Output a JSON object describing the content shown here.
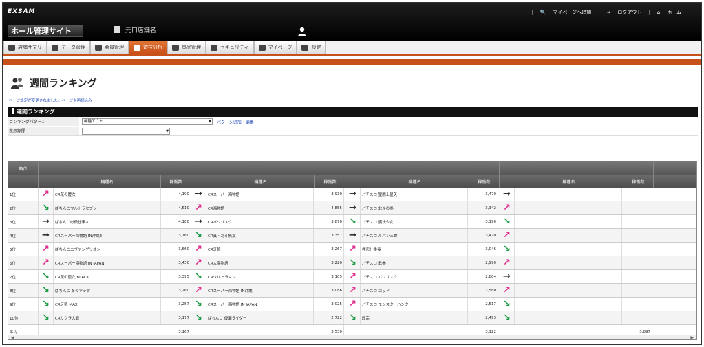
{
  "header": {
    "logo": "EXSAM",
    "site_title": "ホール管理サイト",
    "branch": "元口店舗名",
    "links": [
      "マイページへ追加",
      "ログアウト",
      "ホーム"
    ]
  },
  "nav": {
    "tabs": [
      {
        "label": "店舗サマリ",
        "active": false
      },
      {
        "label": "データ管理",
        "active": false
      },
      {
        "label": "会員管理",
        "active": false
      },
      {
        "label": "遊技分析",
        "active": true
      },
      {
        "label": "景品管理",
        "active": false
      },
      {
        "label": "セキュリティ",
        "active": false
      },
      {
        "label": "マイページ",
        "active": false
      },
      {
        "label": "設定",
        "active": false
      }
    ]
  },
  "page": {
    "title": "週間ランキング",
    "notice": "ページ設定が変更されました。ページを再読込み",
    "section": "週間ランキング"
  },
  "form": {
    "pattern_label": "ランキングパターン",
    "pattern_value": "機種アウト",
    "pattern_link": "パターン追加・編集",
    "period_label": "表示期間",
    "period_value": ""
  },
  "icons": {
    "up": "↗",
    "down": "↘",
    "flat": "→"
  },
  "table": {
    "rank_header": "順位",
    "week_headers": [
      "",
      "",
      "",
      ""
    ],
    "sub_name": "機種名",
    "sub_value": "稼働数",
    "rows": [
      {
        "rank": "1位",
        "c": [
          [
            "up",
            "CR花の慶次",
            "4,190"
          ],
          [
            "flat",
            "CRスーパー海物語",
            "3,930"
          ],
          [
            "flat",
            "パチスロ 聖闘士星矢",
            "3,470"
          ],
          [
            "flat",
            "",
            ""
          ]
        ]
      },
      {
        "rank": "2位",
        "c": [
          [
            "down",
            "ぱちんこウルトラセブン",
            "4,510"
          ],
          [
            "up",
            "CR海物語",
            "4,855"
          ],
          [
            "flat",
            "パチスロ 北斗の拳",
            "3,342"
          ],
          [
            "up",
            "",
            ""
          ]
        ]
      },
      {
        "rank": "3位",
        "c": [
          [
            "flat",
            "ぱちんこ必殺仕事人",
            "4,180"
          ],
          [
            "flat",
            "CRバジリスク",
            "3,870"
          ],
          [
            "down",
            "パチスロ 魔法少女",
            "3,190"
          ],
          [
            "down",
            "",
            ""
          ]
        ]
      },
      {
        "rank": "4位",
        "c": [
          [
            "flat",
            "CRスーパー海物語 IN沖縄3",
            "3,760"
          ],
          [
            "down",
            "CR真・北斗無双",
            "3,357"
          ],
          [
            "flat",
            "パチスロ ルパン三世",
            "3,470"
          ],
          [
            "up",
            "",
            ""
          ]
        ]
      },
      {
        "rank": "5位",
        "c": [
          [
            "up",
            "ぱちんこエヴァンゲリオン",
            "3,660"
          ],
          [
            "up",
            "CR牙狼",
            "3,267"
          ],
          [
            "up",
            "押忍！番長",
            "3,046"
          ],
          [
            "down",
            "",
            ""
          ]
        ]
      },
      {
        "rank": "6位",
        "c": [
          [
            "up",
            "CRスーパー海物語 IN JAPAN",
            "3,430"
          ],
          [
            "up",
            "CR大海物語",
            "3,220"
          ],
          [
            "down",
            "パチスロ 鉄拳",
            "2,990"
          ],
          [
            "up",
            "",
            ""
          ]
        ]
      },
      {
        "rank": "7位",
        "c": [
          [
            "down",
            "CR花の慶次 BLACK",
            "3,395"
          ],
          [
            "down",
            "CRウルトラマン",
            "3,105"
          ],
          [
            "up",
            "パチスロ バジリスク",
            "2,804"
          ],
          [
            "flat",
            "",
            ""
          ]
        ]
      },
      {
        "rank": "8位",
        "c": [
          [
            "down",
            "ぱちんこ 冬のソナタ",
            "3,260"
          ],
          [
            "up",
            "CRスーパー海物語 IN沖縄",
            "3,086"
          ],
          [
            "up",
            "パチスロ ゴッド",
            "2,580"
          ],
          [
            "up",
            "",
            ""
          ]
        ]
      },
      {
        "rank": "9位",
        "c": [
          [
            "down",
            "CR牙狼 MAX",
            "3,257"
          ],
          [
            "down",
            "CRスーパー海物語 IN JAPAN",
            "3,025"
          ],
          [
            "up",
            "パチスロ モンスターハンター",
            "2,517"
          ],
          [
            "down",
            "",
            ""
          ]
        ]
      },
      {
        "rank": "10位",
        "c": [
          [
            "down",
            "CRサクラ大戦",
            "3,177"
          ],
          [
            "down",
            "ぱちんこ 仮面ライダー",
            "2,722"
          ],
          [
            "down",
            "政宗",
            "2,493"
          ],
          [
            "down",
            "",
            ""
          ]
        ]
      }
    ],
    "avg_label": "平均",
    "avg_values": [
      "3,167",
      "3,530",
      "3,122",
      "3,897"
    ]
  }
}
